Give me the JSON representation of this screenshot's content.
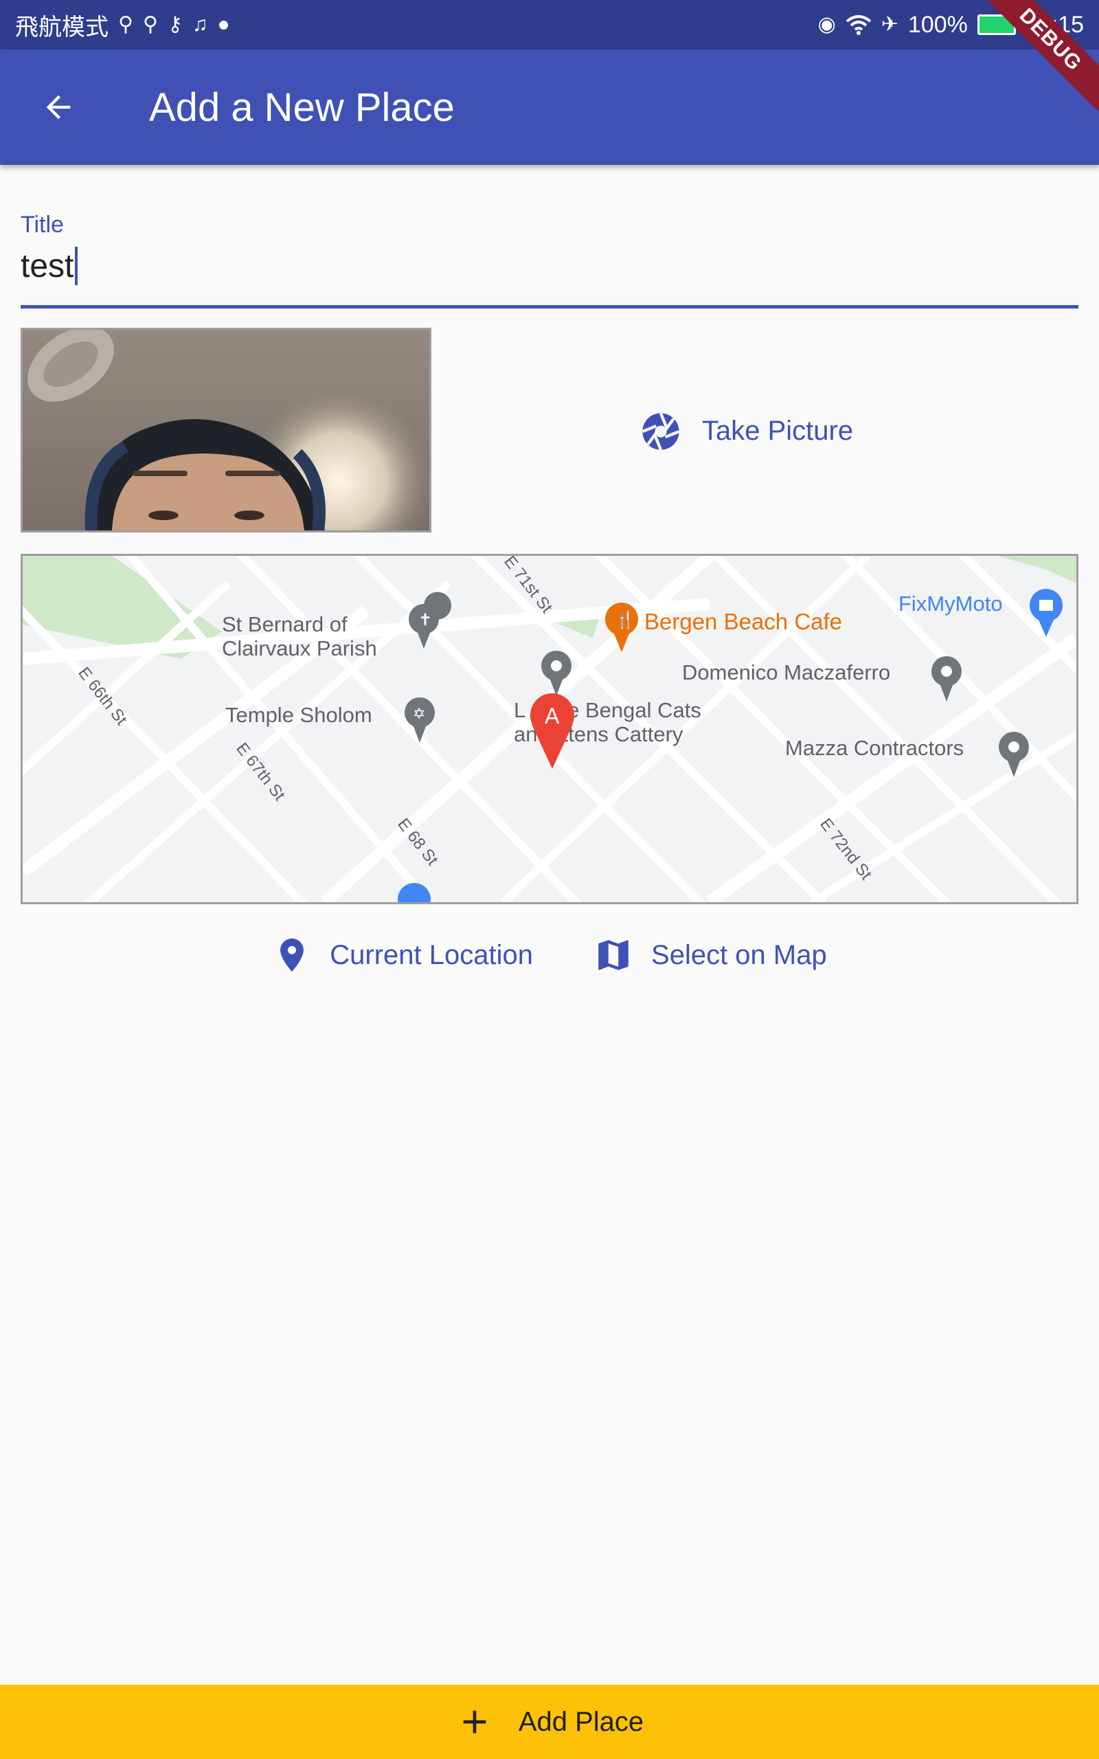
{
  "status_bar": {
    "carrier": "飛航模式",
    "battery": "100%",
    "time": "09:15"
  },
  "debug_banner": "DEBUG",
  "app_bar": {
    "title": "Add a New Place",
    "back_icon": "arrow-back-icon"
  },
  "title_field": {
    "label": "Title",
    "value": "test"
  },
  "image_input": {
    "button_label": "Take Picture",
    "icon": "camera-shutter-icon"
  },
  "map_preview": {
    "places": [
      {
        "label": "St Bernard of"
      },
      {
        "label": "Clairvaux Parish"
      },
      {
        "label": "Bergen Beach Cafe"
      },
      {
        "label": "FixMyMoto"
      },
      {
        "label": "Domenico Maczaferro"
      },
      {
        "label": "Temple Sholom"
      },
      {
        "label": "L   Ange Bengal Cats"
      },
      {
        "label": "an  Kittens Cattery"
      },
      {
        "label": "Mazza Contractors"
      }
    ],
    "streets": [
      "E 66th St",
      "E 67th St",
      "E 68 St",
      "E 71st St",
      "E 72nd St"
    ],
    "marker_label": "A"
  },
  "location_actions": {
    "current_location_label": "Current Location",
    "current_location_icon": "location-pin-icon",
    "select_on_map_label": "Select on Map",
    "select_on_map_icon": "map-icon"
  },
  "add_place_button": {
    "label": "Add Place",
    "icon": "plus-icon"
  },
  "colors": {
    "primary": "#3f51b5",
    "status_bar": "#2f3d8c",
    "accent": "#ffc107",
    "marker": "#ea4335",
    "poi_orange": "#e8710a",
    "poi_blue": "#4285f4"
  }
}
